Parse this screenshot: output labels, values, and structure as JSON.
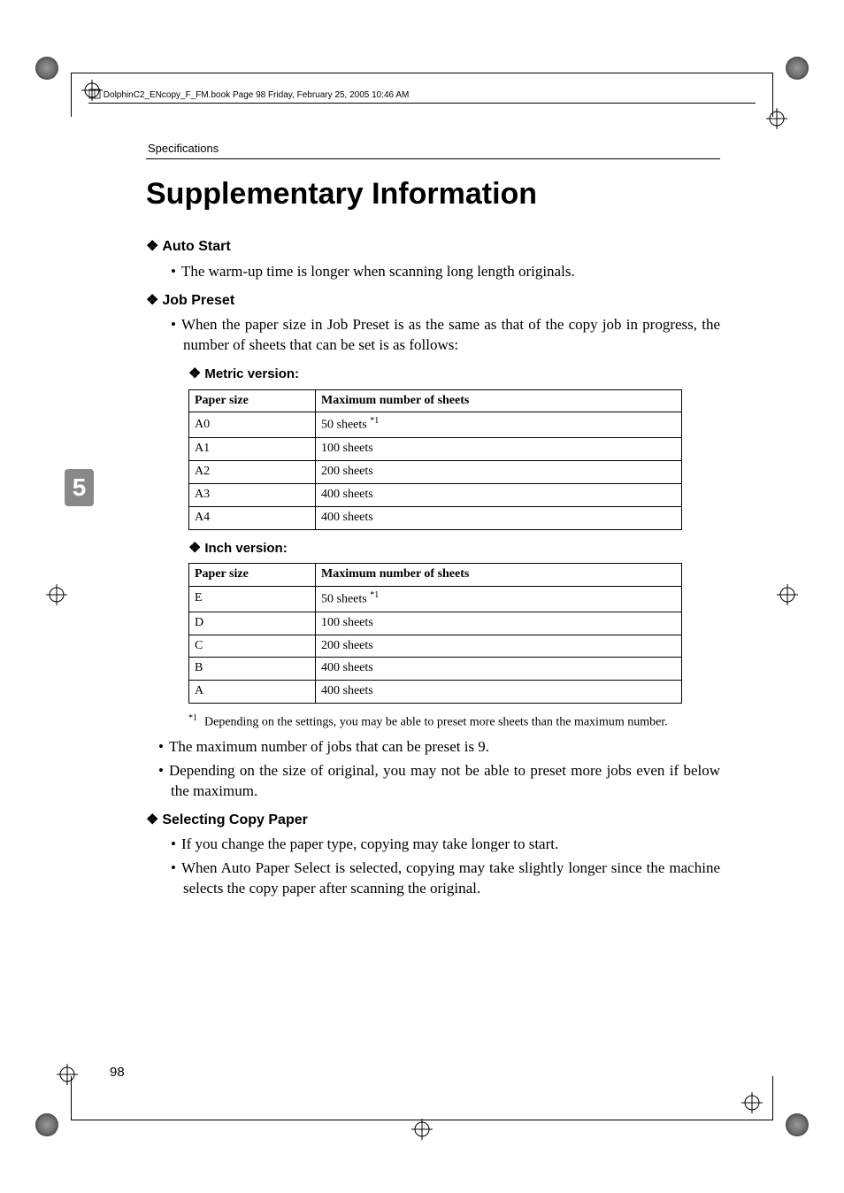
{
  "running_header_line": "DolphinC2_ENcopy_F_FM.book  Page 98  Friday, February 25, 2005  10:46 AM",
  "section_header": "Specifications",
  "page_title": "Supplementary Information",
  "chapter_number": "5",
  "page_number": "98",
  "sections": {
    "auto_start": {
      "heading": "Auto Start",
      "bullets": [
        "The warm-up time is longer when scanning long length originals."
      ]
    },
    "job_preset": {
      "heading": "Job Preset",
      "intro_bullet": "When the paper size in Job Preset is as the same as that of the copy job in progress, the number of sheets that can be set is as follows:",
      "metric_heading": "Metric version:",
      "metric_table": {
        "cols": [
          "Paper size",
          "Maximum number of sheets"
        ],
        "rows": [
          {
            "size": "A0",
            "max": "50 sheets",
            "note": "*1"
          },
          {
            "size": "A1",
            "max": "100 sheets"
          },
          {
            "size": "A2",
            "max": "200 sheets"
          },
          {
            "size": "A3",
            "max": "400 sheets"
          },
          {
            "size": "A4",
            "max": "400 sheets"
          }
        ]
      },
      "inch_heading": "Inch version:",
      "inch_table": {
        "cols": [
          "Paper size",
          "Maximum number of sheets"
        ],
        "rows": [
          {
            "size": "E",
            "max": "50 sheets",
            "note": "*1"
          },
          {
            "size": "D",
            "max": "100 sheets"
          },
          {
            "size": "C",
            "max": "200 sheets"
          },
          {
            "size": "B",
            "max": "400 sheets"
          },
          {
            "size": "A",
            "max": "400 sheets"
          }
        ]
      },
      "footnote_mark": "*1",
      "footnote_text": "Depending on the settings, you may be able to preset more sheets than the maximum number.",
      "post_bullets": [
        "The maximum number of jobs that can be preset is 9.",
        "Depending on the size of original, you may not be able to preset more jobs even if below the maximum."
      ]
    },
    "selecting_copy_paper": {
      "heading": "Selecting Copy Paper",
      "bullets": [
        "If you change the paper type, copying may take longer to start.",
        "When Auto Paper Select is selected, copying may take slightly longer since the machine selects the copy paper after scanning the original."
      ]
    }
  }
}
